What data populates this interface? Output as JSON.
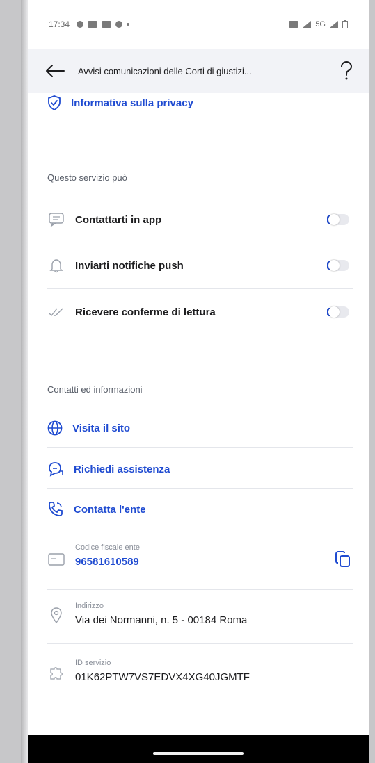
{
  "status_bar": {
    "time": "17:34",
    "network": "5G"
  },
  "header": {
    "title": "Avvisi comunicazioni delle Corti di giustizi..."
  },
  "privacy_link": "Informativa sulla privacy",
  "service_section": {
    "title": "Questo servizio può",
    "toggles": [
      {
        "label": "Contattarti in app",
        "on": true
      },
      {
        "label": "Inviarti notifiche push",
        "on": true
      },
      {
        "label": "Ricevere conferme di lettura",
        "on": true
      }
    ]
  },
  "contacts_section": {
    "title": "Contatti ed informazioni",
    "links": [
      {
        "label": "Visita il sito",
        "icon": "globe-icon"
      },
      {
        "label": "Richiedi assistenza",
        "icon": "chat-support-icon"
      },
      {
        "label": "Contatta l'ente",
        "icon": "phone-icon"
      }
    ],
    "fiscal_code": {
      "label": "Codice fiscale ente",
      "value": "96581610589"
    },
    "address": {
      "label": "Indirizzo",
      "value": "Via dei Normanni, n. 5 - 00184 Roma"
    },
    "service_id": {
      "label": "ID servizio",
      "value": "01K62PTW7VS7EDVX4XG40JGMTF"
    }
  },
  "colors": {
    "accent": "#1f4bd1",
    "header_bg": "#f2f3f7"
  }
}
